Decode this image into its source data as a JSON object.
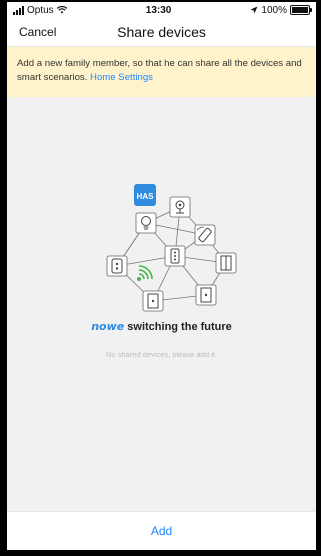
{
  "status_bar": {
    "carrier": "Optus",
    "time": "13:30",
    "battery": "100%",
    "battery_level": 1.0
  },
  "nav": {
    "cancel_label": "Cancel",
    "title": "Share devices"
  },
  "banner": {
    "text": "Add a new family member, so that he can share all the devices and smart scenarios.",
    "link_label": "Home Settings"
  },
  "illustration": {
    "hub_label": "HAS",
    "accent_color": "#2f8bde",
    "wifi_color": "#43b649"
  },
  "brand": {
    "logo": "nowe",
    "slogan": "switching the future"
  },
  "empty_state": "No shared devices, please add it.",
  "footer": {
    "add_label": "Add"
  },
  "colors": {
    "link": "#1e88ff",
    "banner_bg": "#fff3cc",
    "page_bg": "#f1f1f1"
  }
}
